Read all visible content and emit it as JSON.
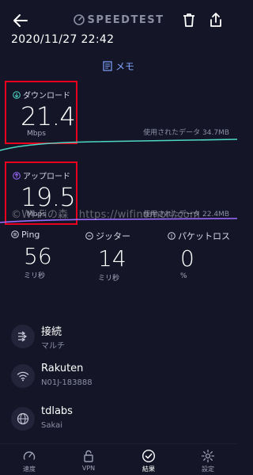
{
  "header": {
    "brand": "SPEEDTEST",
    "datetime": "2020/11/27 22:42",
    "memo": "メモ"
  },
  "download": {
    "label": "ダウンロード",
    "value": "21.4",
    "unit": "Mbps",
    "used": "使用されたデータ 34.7MB"
  },
  "upload": {
    "label": "アップロード",
    "value": "19.5",
    "unit": "Mbps",
    "used": "使用されたデータ 22.4MB"
  },
  "watermark": "©Wi-Fiの森　https://wifinomori.com",
  "stats": {
    "ping": {
      "title": "Ping",
      "value": "56",
      "unit": "ミリ秒"
    },
    "jitter": {
      "title": "ジッター",
      "value": "14",
      "unit": "ミリ秒"
    },
    "loss": {
      "title": "パケットロス",
      "value": "0",
      "unit": "%"
    }
  },
  "info": {
    "connection": {
      "title": "接続",
      "sub": "マルチ"
    },
    "network": {
      "title": "Rakuten",
      "sub": "N01J-183888"
    },
    "server": {
      "title": "tdlabs",
      "sub": "Sakai"
    }
  },
  "nav": {
    "speed": "速度",
    "vpn": "VPN",
    "results": "結果",
    "settings": "設定"
  },
  "colors": {
    "background": "#141526",
    "highlight": "#e8001c",
    "download_line": "#4dd8c6",
    "upload_line": "#9b6cff",
    "memo": "#7fa3ff"
  }
}
